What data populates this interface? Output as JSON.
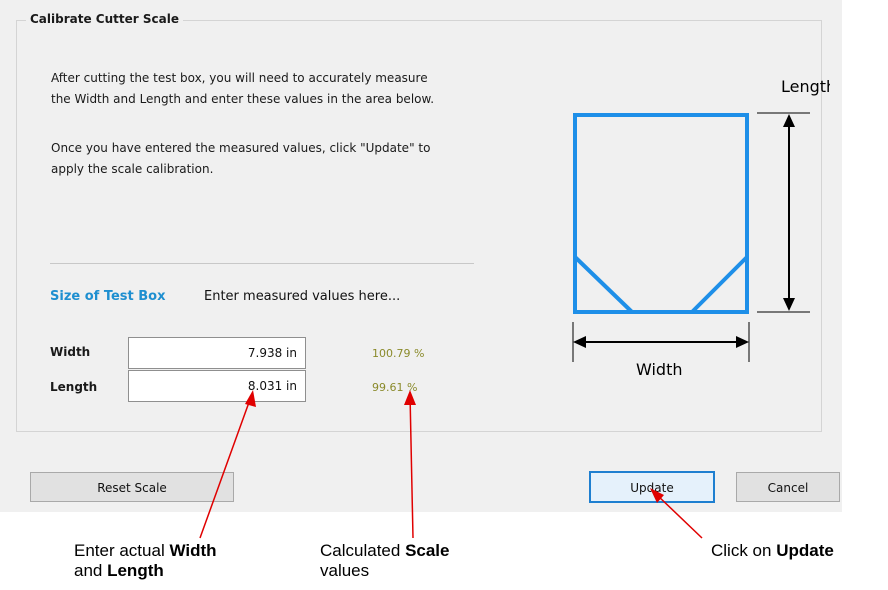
{
  "group_title": "Calibrate Cutter Scale",
  "instructions": {
    "line1": "After cutting the test box, you will need to accurately measure",
    "line2": "the Width and Length and enter these values in the area below.",
    "line3": "Once you have entered the measured values, click \"Update\" to",
    "line4": "apply the scale calibration."
  },
  "section": {
    "title": "Size of Test Box",
    "hint": "Enter measured values here..."
  },
  "fields": {
    "width": {
      "label": "Width",
      "value": "7.938 in",
      "percent": "100.79 %"
    },
    "length": {
      "label": "Length",
      "value": "8.031 in",
      "percent": "99.61 %"
    }
  },
  "diagram": {
    "length_label": "Length",
    "width_label": "Width"
  },
  "buttons": {
    "reset": "Reset Scale",
    "update": "Update",
    "cancel": "Cancel"
  },
  "callouts": {
    "c1_prefix": "Enter actual ",
    "c1_bold1": "Width",
    "c1_mid": "and ",
    "c1_bold2": "Length",
    "c2_prefix": "Calculated ",
    "c2_bold": "Scale",
    "c2_line2": "values",
    "c3_prefix": "Click on ",
    "c3_bold": "Update"
  },
  "colors": {
    "accent": "#1e8fd0",
    "box_blue": "#1e8fe8",
    "percent": "#8a8a2a",
    "arrow_red": "#e00000"
  }
}
